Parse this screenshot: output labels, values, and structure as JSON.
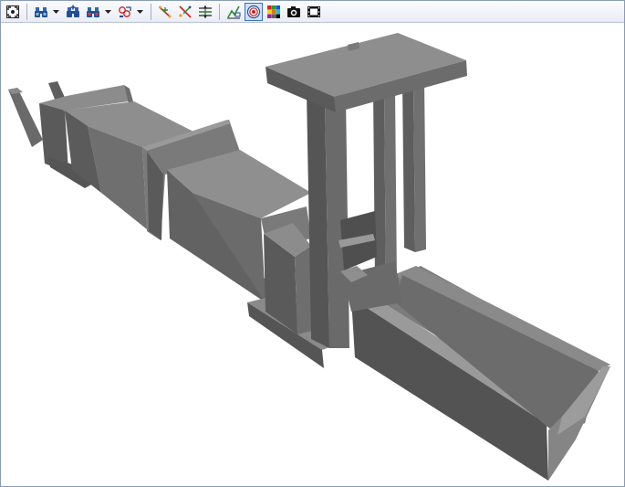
{
  "toolbar": {
    "buttons": [
      {
        "icon": "zoom-extents-icon"
      },
      {
        "icon": "binoculars-icon",
        "has_dropdown": true
      },
      {
        "icon": "binoculars-plus-icon"
      },
      {
        "icon": "binoculars-red-icon",
        "has_dropdown": true
      },
      {
        "icon": "select-objects-icon",
        "has_dropdown": true
      },
      {
        "icon": "node-vector-icon"
      },
      {
        "icon": "node-cross-icon"
      },
      {
        "icon": "dimension-arrows-icon"
      },
      {
        "icon": "function-xyz-icon"
      },
      {
        "icon": "render-target-icon",
        "active": true
      },
      {
        "icon": "color-palette-icon"
      },
      {
        "icon": "camera-icon"
      },
      {
        "icon": "film-frame-icon"
      }
    ]
  },
  "viewport": {
    "model_color": "#777777",
    "background": "#ffffff"
  }
}
